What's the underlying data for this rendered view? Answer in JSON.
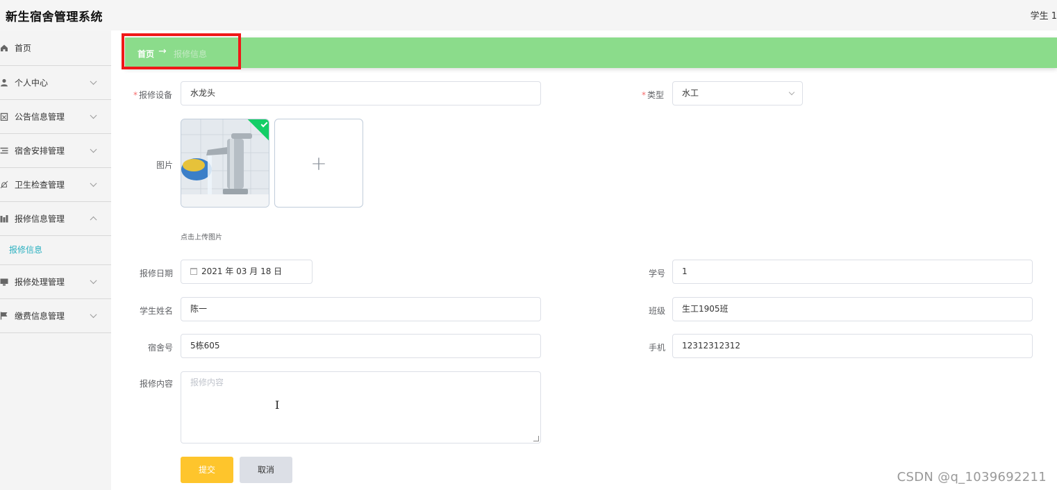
{
  "header": {
    "app_title": "新生宿舍管理系统",
    "user": "学生 1"
  },
  "sidebar": {
    "items": [
      {
        "label": "首页",
        "icon": "home-icon"
      },
      {
        "label": "个人中心",
        "icon": "user-icon"
      },
      {
        "label": "公告信息管理",
        "icon": "clipboard-icon"
      },
      {
        "label": "宿舍安排管理",
        "icon": "list-icon"
      },
      {
        "label": "卫生检查管理",
        "icon": "bell-off-icon"
      },
      {
        "label": "报修信息管理",
        "icon": "chart-icon"
      },
      {
        "label": "报修处理管理",
        "icon": "monitor-icon"
      },
      {
        "label": "缴费信息管理",
        "icon": "flag-icon"
      }
    ],
    "submenu_label": "报修信息"
  },
  "breadcrumb": {
    "home": "首页",
    "separator": "→",
    "current": "报修信息"
  },
  "form": {
    "device_label": "报修设备",
    "device_value": "水龙头",
    "type_label": "类型",
    "type_value": "水工",
    "image_label": "图片",
    "upload_tip": "点击上传图片",
    "date_label": "报修日期",
    "date_value": "2021 年 03 月 18 日",
    "student_no_label": "学号",
    "student_no_value": "1",
    "name_label": "学生姓名",
    "name_value": "陈一",
    "class_label": "班级",
    "class_value": "生工1905班",
    "dorm_label": "宿舍号",
    "dorm_value": "5栋605",
    "phone_label": "手机",
    "phone_value": "12312312312",
    "content_label": "报修内容",
    "content_placeholder": "报修内容",
    "submit_label": "提交",
    "cancel_label": "取消"
  },
  "watermark": "CSDN @q_1039692211",
  "colors": {
    "breadcrumb_bar": "#8bdc8b",
    "highlight": "#f01818",
    "submit": "#fec52c",
    "active_submenu": "#2bb0c0",
    "required": "#f56c6c"
  }
}
